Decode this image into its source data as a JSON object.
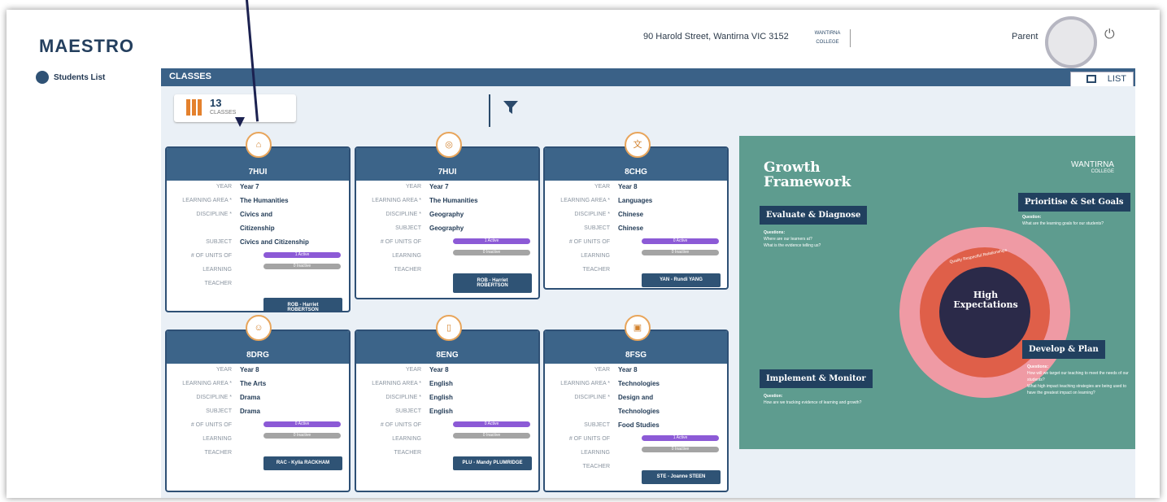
{
  "header": {
    "logo": "MAESTRO",
    "address": "90 Harold Street, Wantirna VIC 3152",
    "school_mini": "WANTIRNA COLLEGE",
    "role": "Parent",
    "power_icon": "power-icon"
  },
  "sidebar": {
    "students_list": "Students List"
  },
  "page": {
    "title": "CLASSES",
    "list_btn": "LIST",
    "count": "13",
    "count_label": "CLASSES"
  },
  "labels": {
    "year": "YEAR",
    "learning_area": "LEARNING AREA *",
    "discipline": "DISCIPLINE *",
    "subject": "SUBJECT",
    "units_a": "# OF UNITS OF",
    "units_b": "LEARNING",
    "teacher": "TEACHER"
  },
  "cards": [
    {
      "title": "7HUI",
      "year": "Year 7",
      "area": "The Humanities",
      "discipline_a": "Civics and",
      "discipline_b": "Citizenship",
      "subject": "Civics and Citizenship",
      "active": "1 Active",
      "inactive": "0 Inactive",
      "teacher_a": "ROB - Harriet",
      "teacher_b": "ROBERTSON"
    },
    {
      "title": "7HUI",
      "year": "Year 7",
      "area": "The Humanities",
      "discipline": "Geography",
      "subject": "Geography",
      "active": "1 Active",
      "inactive": "0 Inactive",
      "teacher_a": "ROB - Harriet",
      "teacher_b": "ROBERTSON"
    },
    {
      "title": "8CHG",
      "year": "Year 8",
      "area": "Languages",
      "discipline": "Chinese",
      "subject": "Chinese",
      "active": "0 Active",
      "inactive": "0 Inactive",
      "teacher": "YAN - Rundi YANG"
    },
    {
      "title": "8DRG",
      "year": "Year 8",
      "area": "The Arts",
      "discipline": "Drama",
      "subject": "Drama",
      "active": "0 Active",
      "inactive": "0 Inactive",
      "teacher": "RAC - Kylia RACKHAM"
    },
    {
      "title": "8ENG",
      "year": "Year 8",
      "area": "English",
      "discipline": "English",
      "subject": "English",
      "active": "0 Active",
      "inactive": "0 Inactive",
      "teacher": "PLU - Mandy PLUMRIDGE"
    },
    {
      "title": "8FSG",
      "year": "Year 8",
      "area": "Technologies",
      "discipline_a": "Design and",
      "discipline_b": "Technologies",
      "subject": "Food Studies",
      "active": "1 Active",
      "inactive": "0 Inactive",
      "teacher": "STE - Joanne STEEN"
    }
  ],
  "growth": {
    "title_a": "Growth",
    "title_b": "Framework",
    "logo": "WANTIRNA",
    "logo_sub": "COLLEGE",
    "evaluate": "Evaluate & Diagnose",
    "prioritise": "Prioritise & Set Goals",
    "implement": "Implement & Monitor",
    "develop": "Develop & Plan",
    "center_a": "High",
    "center_b": "Expectations",
    "ring_label": "Quality Respectful Relationships",
    "questions": "Questions:",
    "question": "Question:",
    "q_eval_1": "Where are our learners at?",
    "q_eval_2": "What is the evidence telling us?",
    "q_prior": "What are the learning goals for our students?",
    "q_impl": "How are we tracking evidence of learning and growth?",
    "q_dev_1": "How will we target our teaching to meet the needs of our students?",
    "q_dev_2": "What high impact teaching strategies are being used to have the greatest impact on learning?"
  }
}
